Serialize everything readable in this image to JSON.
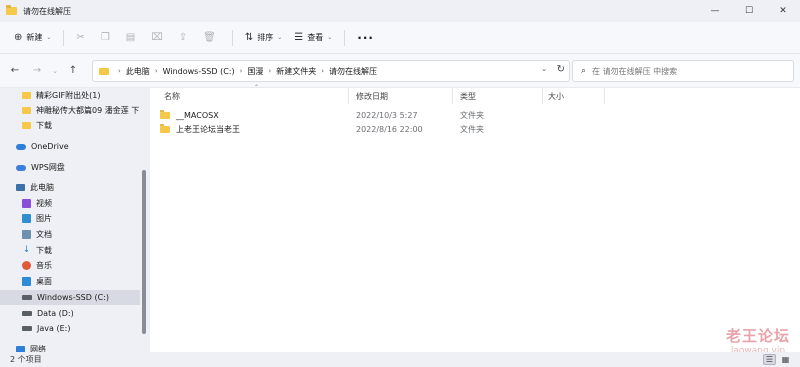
{
  "window": {
    "title": "请勿在线解压",
    "controls": [
      "—",
      "☐",
      "✕"
    ]
  },
  "toolbar": {
    "new_label": "新建",
    "sort_label": "排序",
    "view_label": "查看",
    "more_label": "···"
  },
  "address": {
    "crumbs": [
      "此电脑",
      "Windows-SSD (C:)",
      "国漫",
      "新建文件夹",
      "请勿在线解压"
    ]
  },
  "search": {
    "placeholder": "在 请勿在线解压 中搜索"
  },
  "nav": {
    "items": [
      {
        "label": "精彩GIF附出处(1)",
        "icon": "folder-icon"
      },
      {
        "label": "神雕秘传大都篇09 潘金莲 下",
        "icon": "folder-icon"
      },
      {
        "label": "下载",
        "icon": "folder-icon"
      },
      {
        "label": "OneDrive",
        "icon": "cloud-icon"
      },
      {
        "label": "WPS网盘",
        "icon": "wps-cloud-icon"
      },
      {
        "label": "此电脑",
        "icon": "computer-icon"
      },
      {
        "label": "视频",
        "icon": "video-icon"
      },
      {
        "label": "图片",
        "icon": "pictures-icon"
      },
      {
        "label": "文档",
        "icon": "documents-icon"
      },
      {
        "label": "下载",
        "icon": "download-icon"
      },
      {
        "label": "音乐",
        "icon": "music-icon"
      },
      {
        "label": "桌面",
        "icon": "desktop-icon"
      },
      {
        "label": "Windows-SSD (C:)",
        "icon": "drive-icon"
      },
      {
        "label": "Data (D:)",
        "icon": "drive-icon"
      },
      {
        "label": "Java (E:)",
        "icon": "drive-icon"
      },
      {
        "label": "网络",
        "icon": "network-icon"
      }
    ]
  },
  "columns": {
    "name": "名称",
    "modified": "修改日期",
    "type": "类型",
    "size": "大小"
  },
  "files": [
    {
      "name": "__MACOSX",
      "modified": "2022/10/3 5:27",
      "type": "文件夹",
      "size": ""
    },
    {
      "name": "上老王论坛当老王",
      "modified": "2022/8/16 22:00",
      "type": "文件夹",
      "size": ""
    }
  ],
  "status": {
    "item_count": "2 个项目"
  },
  "watermark": {
    "cn": "老王论坛",
    "en": "laowang.vip"
  }
}
